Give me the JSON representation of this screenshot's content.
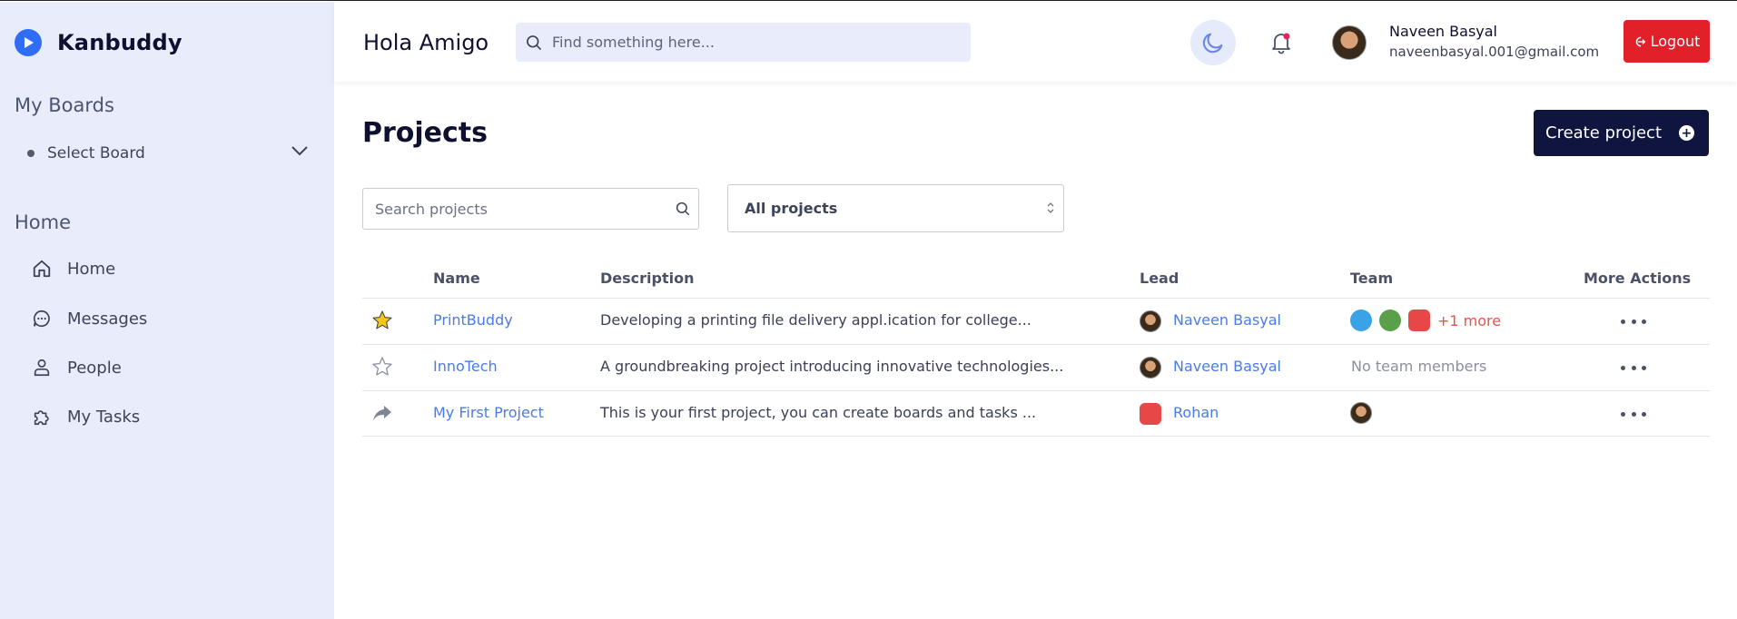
{
  "brand": {
    "name": "Kanbuddy"
  },
  "sidebar": {
    "boards_title": "My Boards",
    "select_board_label": "Select Board",
    "home_title": "Home",
    "items": [
      {
        "label": "Home",
        "icon": "home-icon"
      },
      {
        "label": "Messages",
        "icon": "chat-icon"
      },
      {
        "label": "People",
        "icon": "people-icon"
      },
      {
        "label": "My Tasks",
        "icon": "puzzle-icon"
      }
    ]
  },
  "header": {
    "greeting": "Hola Amigo",
    "search_placeholder": "Find something here...",
    "user_name": "Naveen Basyal",
    "user_email": "naveenbasyal.001@gmail.com",
    "logout_label": "Logout"
  },
  "main": {
    "title": "Projects",
    "create_label": "Create project",
    "search_placeholder": "Search projects",
    "filter_value": "All projects",
    "columns": {
      "name": "Name",
      "description": "Description",
      "lead": "Lead",
      "team": "Team",
      "actions": "More Actions"
    },
    "rows": [
      {
        "star": "filled",
        "name": "PrintBuddy",
        "description": "Developing a printing file delivery appl.ication for college...",
        "lead": "Naveen Basyal",
        "team_more": "+1 more",
        "no_team": ""
      },
      {
        "star": "outline",
        "name": "InnoTech",
        "description": "A groundbreaking project introducing innovative technologies...",
        "lead": "Naveen Basyal",
        "team_more": "",
        "no_team": "No team members"
      },
      {
        "star": "shared",
        "name": "My First Project",
        "description": "This is your first project, you can create boards and tasks ...",
        "lead": "Rohan",
        "team_more": "",
        "no_team": ""
      }
    ]
  },
  "colors": {
    "sidebar_bg": "#e9edfb",
    "accent_link": "#4a7be8",
    "logout_red": "#e2202a",
    "primary_dark": "#101540",
    "star_gold": "#f5c518"
  }
}
